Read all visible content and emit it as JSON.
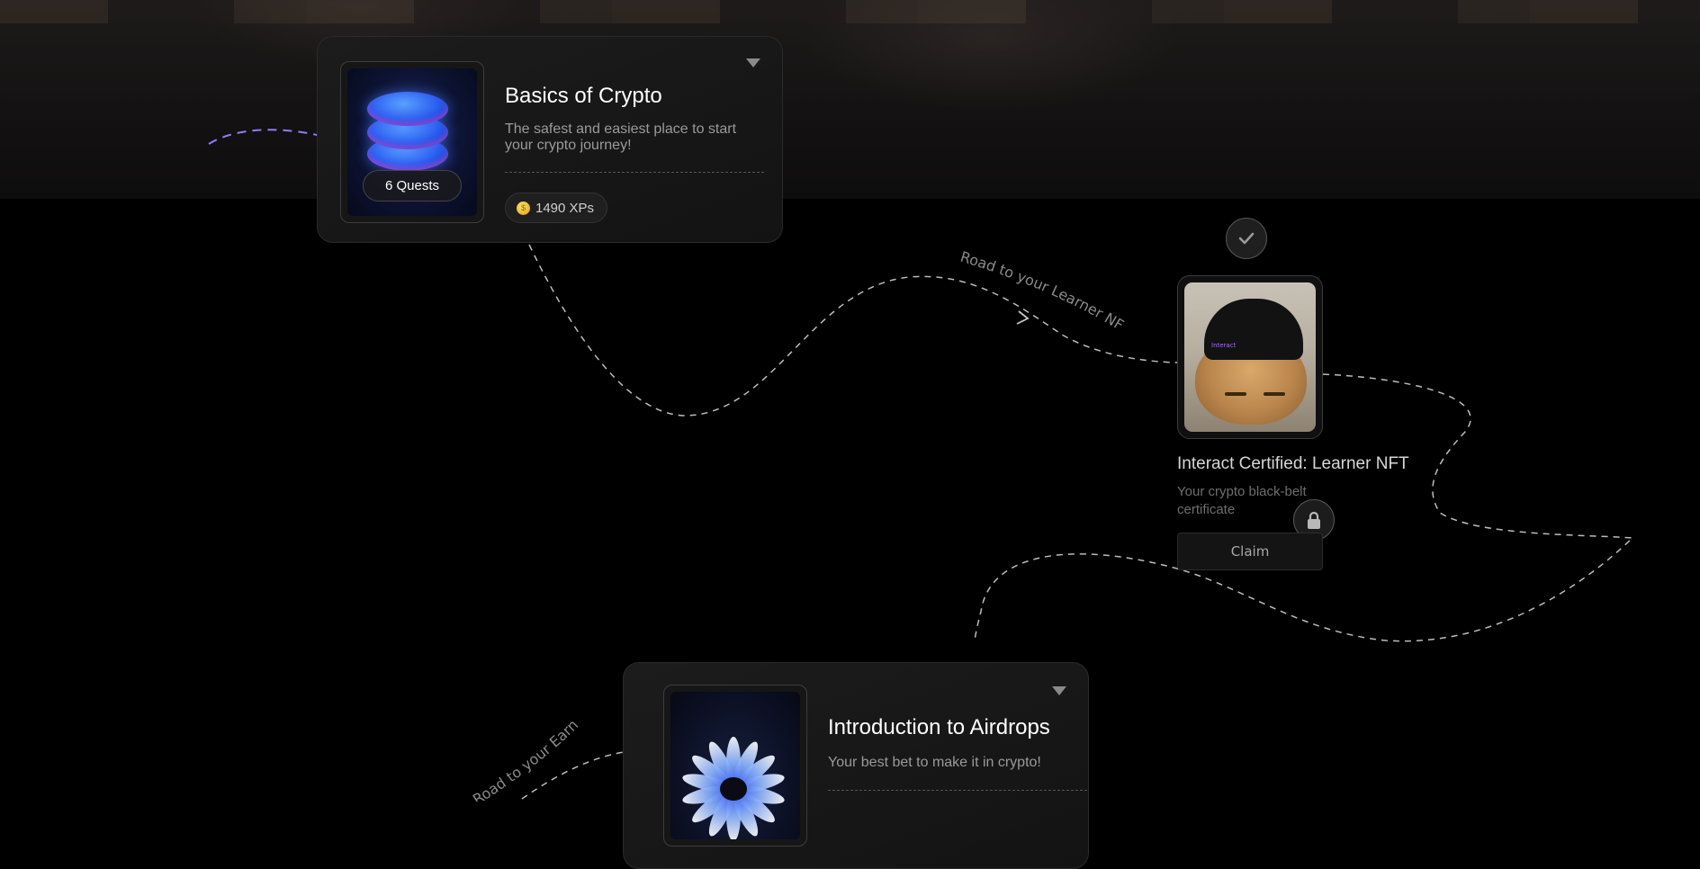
{
  "course_1": {
    "title": "Basics of Crypto",
    "description": "The safest and easiest place to start your crypto journey!",
    "quests_label": "6 Quests",
    "xp_label": "1490 XPs",
    "thumbnail_icon": "stacked-disks-icon",
    "toggle_icon": "caret-down-icon"
  },
  "path_label_1": "Road to your Learner NFT",
  "nft": {
    "title": "Interact Certified: Learner NFT",
    "subtitle": "Your crypto black-belt certificate",
    "claim_label": "Claim",
    "beanie_text": "Interact",
    "status_icon": "check-icon",
    "lock_icon": "lock-icon"
  },
  "path_label_2": "Road to your Earner NFT",
  "course_2": {
    "title": "Introduction to Airdrops",
    "description": "Your best bet to make it in crypto!",
    "thumbnail_icon": "flower-icon",
    "toggle_icon": "caret-down-icon"
  },
  "colors": {
    "background": "#000000",
    "card": "#161616",
    "path_dash": "#bdbdbd",
    "accent_purple": "#8f7cff",
    "coin": "#f2c230"
  }
}
